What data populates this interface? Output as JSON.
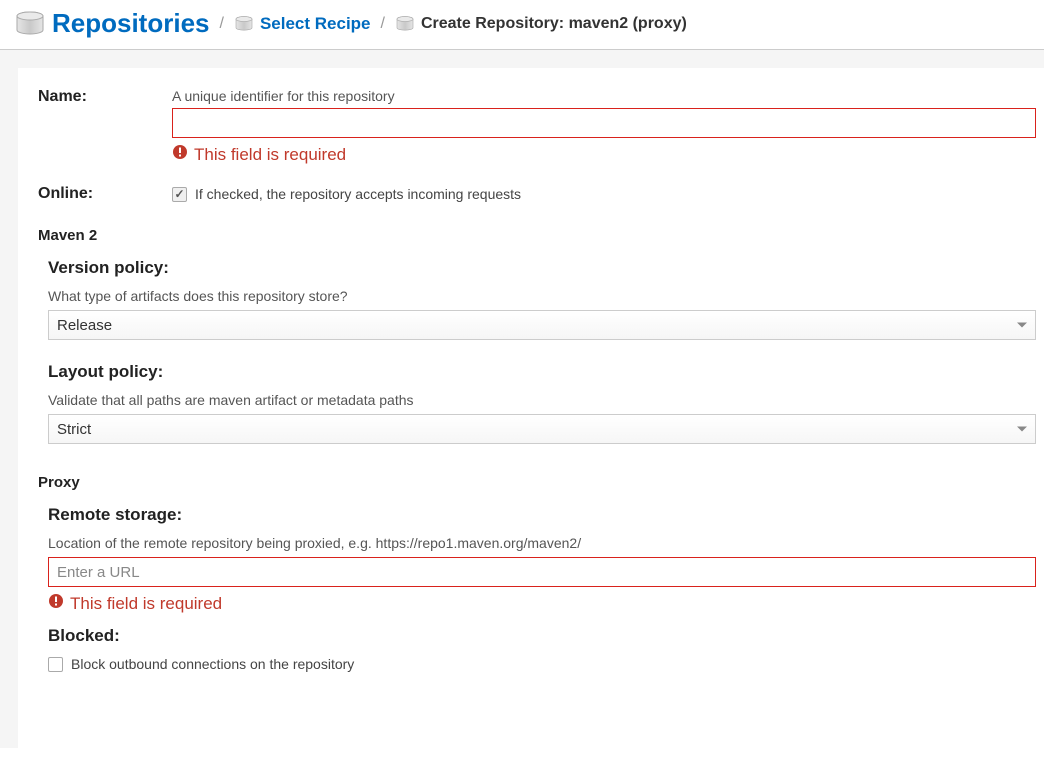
{
  "breadcrumb": {
    "root": "Repositories",
    "select_recipe": "Select Recipe",
    "current": "Create Repository: maven2 (proxy)"
  },
  "fields": {
    "name": {
      "label": "Name:",
      "help": "A unique identifier for this repository",
      "error": "This field is required"
    },
    "online": {
      "label": "Online:",
      "checkbox_text": "If checked, the repository accepts incoming requests",
      "checked": true
    }
  },
  "sections": {
    "maven2": {
      "title": "Maven 2",
      "version_policy": {
        "label": "Version policy:",
        "help": "What type of artifacts does this repository store?",
        "value": "Release"
      },
      "layout_policy": {
        "label": "Layout policy:",
        "help": "Validate that all paths are maven artifact or metadata paths",
        "value": "Strict"
      }
    },
    "proxy": {
      "title": "Proxy",
      "remote_storage": {
        "label": "Remote storage:",
        "help": "Location of the remote repository being proxied, e.g. https://repo1.maven.org/maven2/",
        "placeholder": "Enter a URL",
        "error": "This field is required"
      },
      "blocked": {
        "label": "Blocked:",
        "checkbox_text": "Block outbound connections on the repository",
        "checked": false
      }
    }
  }
}
